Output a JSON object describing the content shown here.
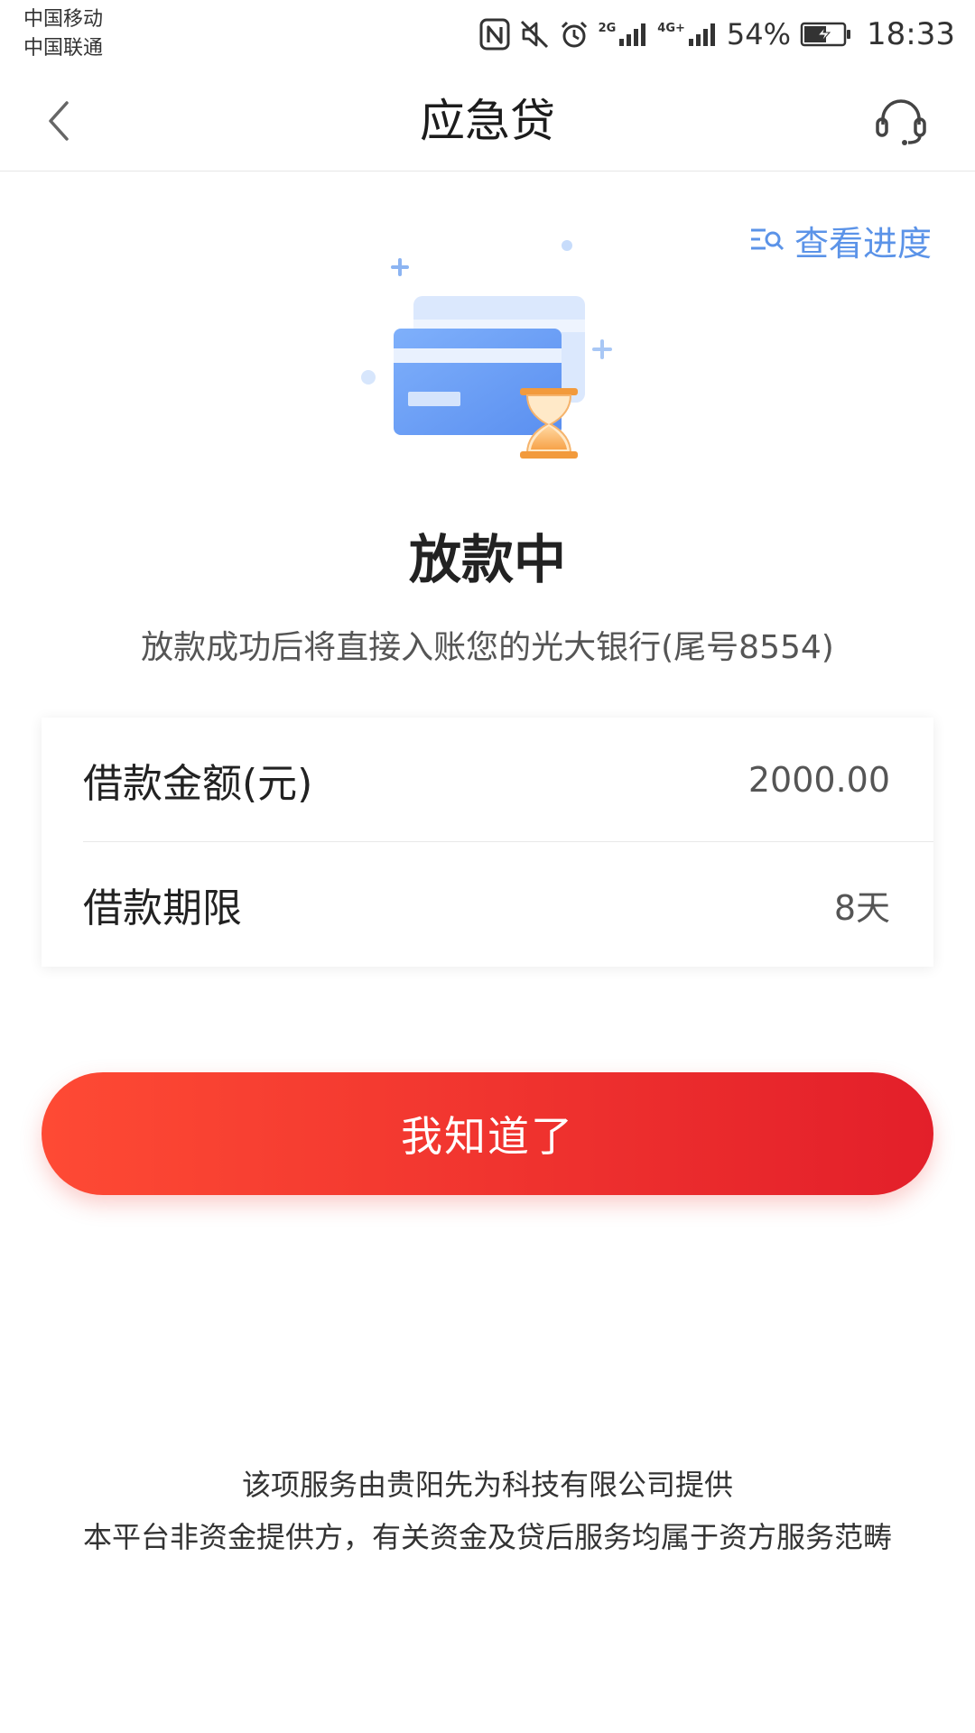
{
  "status_bar": {
    "carrier_1": "中国移动",
    "carrier_2": "中国联通",
    "network_1": "2G",
    "network_2": "4G+",
    "battery": "54%",
    "time": "18:33"
  },
  "navbar": {
    "title": "应急贷",
    "back_icon": "chevron-left-icon",
    "service_icon": "headset-icon"
  },
  "progress_link": {
    "label": "查看进度"
  },
  "status": {
    "title": "放款中",
    "description": "放款成功后将直接入账您的光大银行(尾号8554)"
  },
  "details": [
    {
      "label": "借款金额(元)",
      "value": "2000.00"
    },
    {
      "label": "借款期限",
      "value": "8天"
    }
  ],
  "confirm_button": {
    "label": "我知道了"
  },
  "footer": {
    "line_1": "该项服务由贵阳先为科技有限公司提供",
    "line_2": "本平台非资金提供方，有关资金及贷后服务均属于资方服务范畴"
  },
  "colors": {
    "accent_blue": "#5b93e8",
    "button_start": "#fe4a34",
    "button_end": "#e31f2a"
  }
}
